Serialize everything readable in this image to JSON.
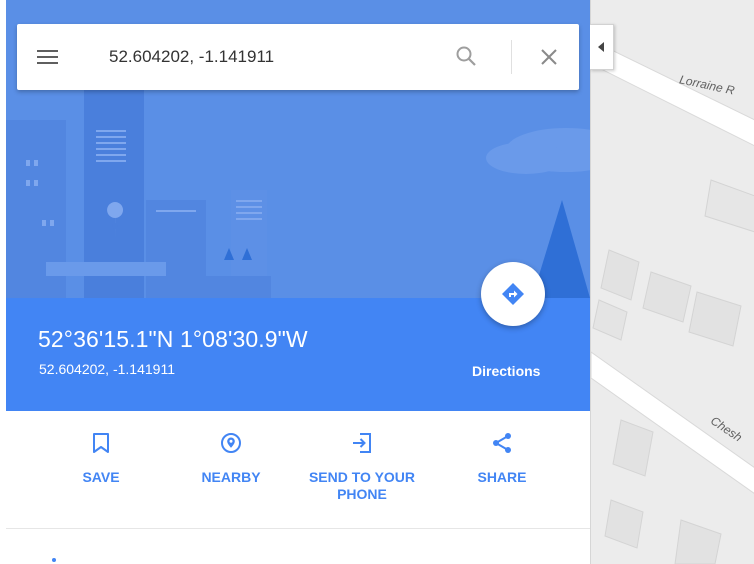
{
  "search": {
    "value": "52.604202, -1.141911",
    "menu_icon": "hamburger-menu-icon",
    "search_icon": "search-icon",
    "clear_icon": "close-icon"
  },
  "place": {
    "coordinates_dms": "52°36'15.1\"N 1°08'30.9\"W",
    "coordinates_decimal": "52.604202, -1.141911",
    "directions_label": "Directions",
    "directions_icon": "directions-diamond-icon"
  },
  "actions": [
    {
      "label": "SAVE",
      "icon": "bookmark-icon"
    },
    {
      "label": "NEARBY",
      "icon": "place-pin-icon"
    },
    {
      "label": "SEND TO YOUR PHONE",
      "icon": "send-to-device-icon"
    },
    {
      "label": "SHARE",
      "icon": "share-icon"
    }
  ],
  "map": {
    "roads": [
      {
        "label": "Lorraine R"
      },
      {
        "label": "Chesh"
      }
    ],
    "collapse_icon": "collapse-panel-arrow-icon"
  },
  "colors": {
    "accent": "#4285f4",
    "hero_background": "#5a8fe6",
    "map_background": "#ececec"
  }
}
